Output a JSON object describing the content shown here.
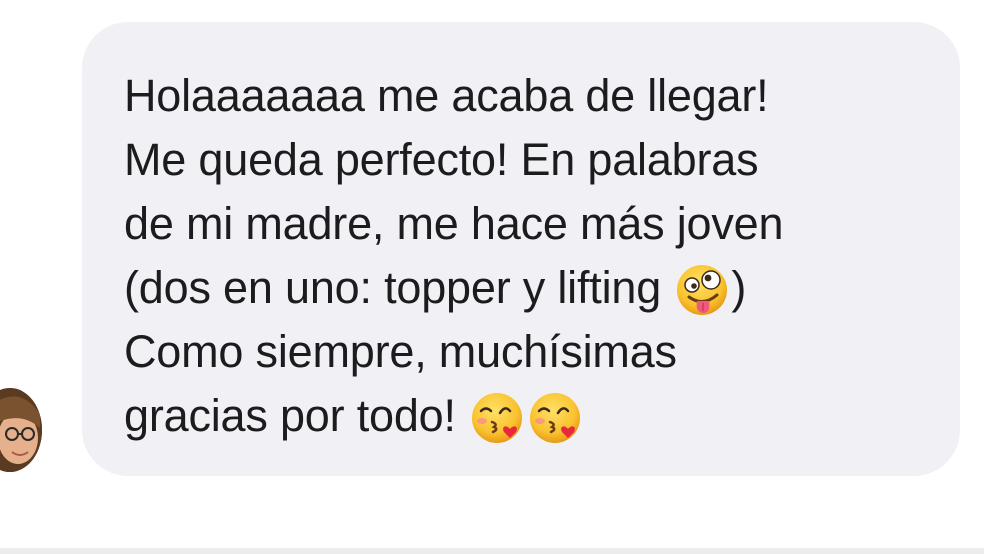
{
  "conversation": {
    "message": {
      "lines": [
        "Holaaaaaaa me acaba de llegar!",
        "Me queda perfecto! En palabras",
        "de mi madre, me hace más joven",
        "(dos en uno: topper y lifting",
        ")",
        "Como siempre, muchísimas",
        "gracias por todo!"
      ],
      "emojis": {
        "zany": "zany-face-emoji",
        "kiss": "face-blowing-kiss-emoji"
      }
    },
    "sender": {
      "avatar_icon": "avatar-photo"
    },
    "colors": {
      "bubble": "#f1f0f5",
      "text": "#1c1c1e",
      "background": "#ffffff"
    }
  }
}
